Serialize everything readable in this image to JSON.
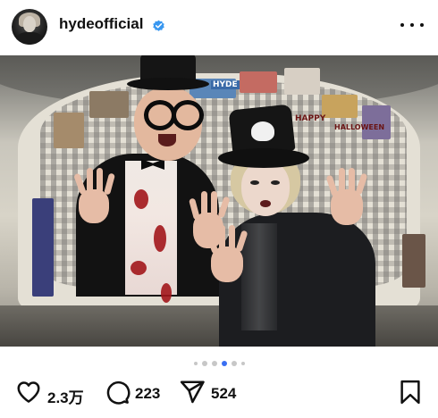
{
  "post": {
    "username": "hydeofficial",
    "verified": true,
    "more_icon": "more-horizontal-icon"
  },
  "image": {
    "carousel_total": 6,
    "carousel_active_index": 3,
    "wall_sign_texts": [
      "HYDE",
      "HAPPY",
      "HALLOWEEN"
    ]
  },
  "actions": {
    "like_icon": "heart-icon",
    "like_count": "2.3万",
    "comment_icon": "comment-icon",
    "comment_count": "223",
    "share_icon": "share-paper-plane-icon",
    "share_count": "524",
    "save_icon": "bookmark-icon"
  },
  "colors": {
    "verified_badge": "#3897f0",
    "carousel_active": "#3a6ff2",
    "carousel_inactive": "#c7c7c7",
    "text": "#111111"
  }
}
